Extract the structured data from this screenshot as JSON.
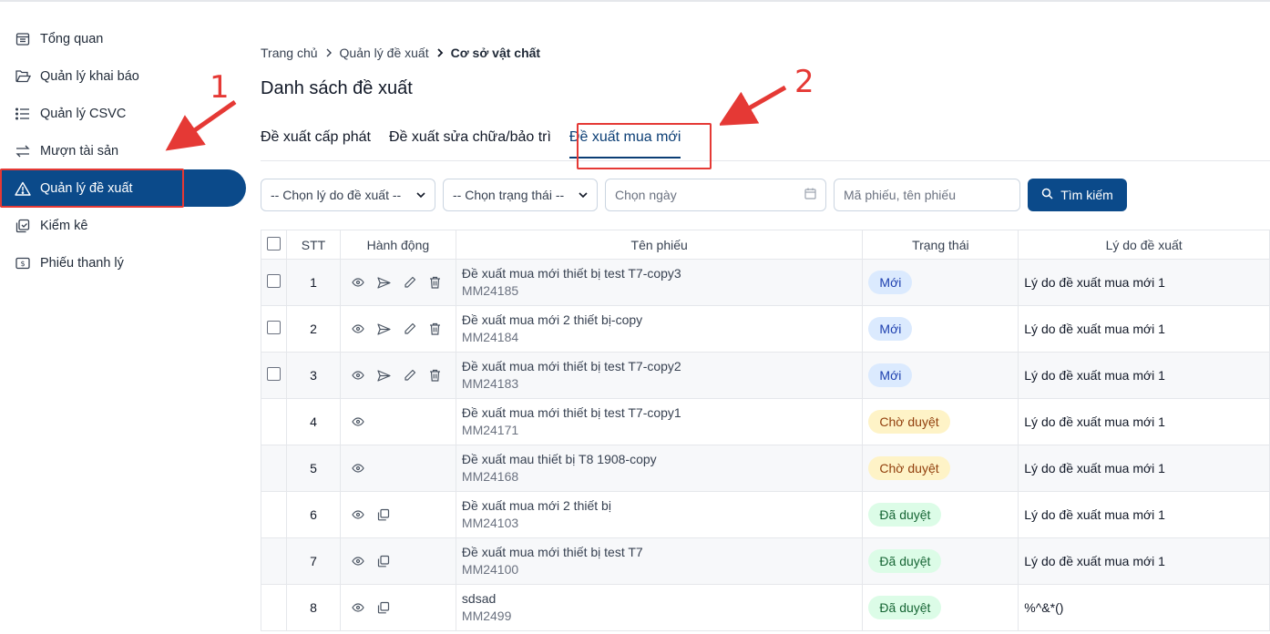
{
  "sidebar": {
    "items": [
      {
        "label": "Tổng quan",
        "icon": "dashboard-icon"
      },
      {
        "label": "Quản lý khai báo",
        "icon": "folder-open-icon"
      },
      {
        "label": "Quản lý CSVC",
        "icon": "list-icon"
      },
      {
        "label": "Mượn tài sản",
        "icon": "swap-icon"
      },
      {
        "label": "Quản lý đề xuất",
        "icon": "warning-icon",
        "active": true
      },
      {
        "label": "Kiểm kê",
        "icon": "inventory-icon"
      },
      {
        "label": "Phiếu thanh lý",
        "icon": "receipt-icon"
      }
    ]
  },
  "breadcrumb": {
    "home": "Trang chủ",
    "parent": "Quản lý đề xuất",
    "current": "Cơ sở vật chất"
  },
  "page_title": "Danh sách đề xuất",
  "tabs": [
    {
      "label": "Đề xuất cấp phát"
    },
    {
      "label": "Đề xuất sửa chữa/bảo trì"
    },
    {
      "label": "Đề xuất mua mới",
      "active": true
    }
  ],
  "filters": {
    "reason_select": "-- Chọn lý do đề xuất --",
    "status_select": "-- Chọn trạng thái --",
    "date_placeholder": "Chọn ngày",
    "search_placeholder": "Mã phiếu, tên phiếu",
    "search_button": "Tìm kiếm"
  },
  "table": {
    "headers": {
      "stt": "STT",
      "actions": "Hành động",
      "name": "Tên phiếu",
      "status": "Trạng thái",
      "reason": "Lý do đề xuất"
    },
    "rows": [
      {
        "stt": "1",
        "name": "Đề xuất mua mới thiết bị test T7-copy3",
        "code": "MM24185",
        "status": "Mới",
        "reason": "Lý do đề xuất mua mới 1"
      },
      {
        "stt": "2",
        "name": "Đề xuất mua mới 2 thiết bị-copy",
        "code": "MM24184",
        "status": "Mới",
        "reason": "Lý do đề xuất mua mới 1"
      },
      {
        "stt": "3",
        "name": "Đề xuất mua mới thiết bị test T7-copy2",
        "code": "MM24183",
        "status": "Mới",
        "reason": "Lý do đề xuất mua mới 1"
      },
      {
        "stt": "4",
        "name": "Đề xuất mua mới thiết bị test T7-copy1",
        "code": "MM24171",
        "status": "Chờ duyệt",
        "reason": "Lý do đề xuất mua mới 1"
      },
      {
        "stt": "5",
        "name": "Đề xuất mau thiết bị T8 1908-copy",
        "code": "MM24168",
        "status": "Chờ duyệt",
        "reason": "Lý do đề xuất mua mới 1"
      },
      {
        "stt": "6",
        "name": "Đề xuất mua mới 2 thiết bị",
        "code": "MM24103",
        "status": "Đã duyệt",
        "reason": "Lý do đề xuất mua mới 1"
      },
      {
        "stt": "7",
        "name": "Đề xuất mua mới thiết bị test T7",
        "code": "MM24100",
        "status": "Đã duyệt",
        "reason": "Lý do đề xuất mua mới 1"
      },
      {
        "stt": "8",
        "name": "sdsad",
        "code": "MM2499",
        "status": "Đã duyệt",
        "reason": "%^&*()"
      }
    ]
  },
  "annotations": {
    "step1": "1",
    "step2": "2",
    "color": "#e53935"
  },
  "colors": {
    "primary": "#0b4a8a",
    "badge_new": "#dbeafe",
    "badge_wait": "#fef3c7",
    "badge_ok": "#dcfce7"
  }
}
